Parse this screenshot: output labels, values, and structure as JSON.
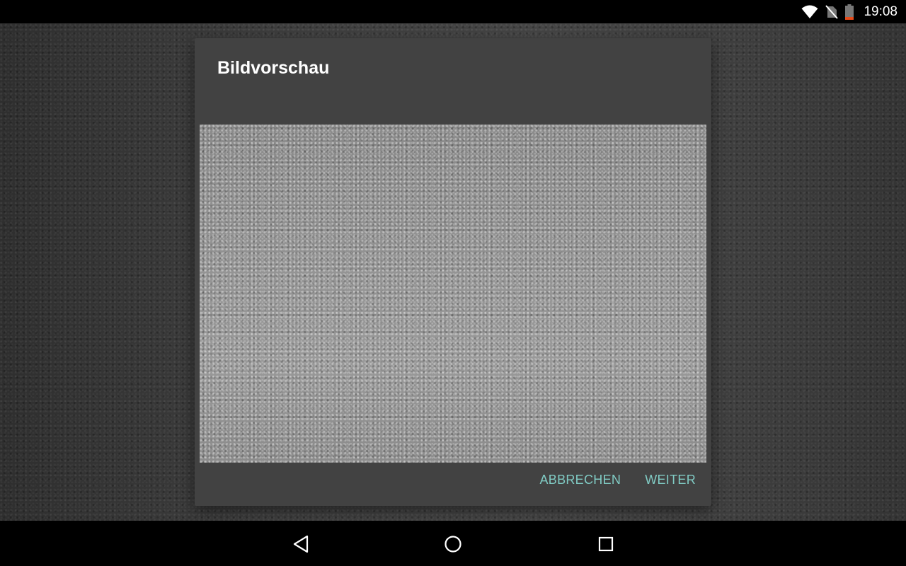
{
  "status_bar": {
    "time": "19:08",
    "icons": [
      "wifi-icon",
      "no-sim-icon",
      "battery-low-icon"
    ]
  },
  "dialog": {
    "title": "Bildvorschau",
    "preview_image": "textured-wall-photo",
    "cancel_label": "ABBRECHEN",
    "continue_label": "WEITER"
  },
  "nav_bar": {
    "icons": [
      "back-icon",
      "home-icon",
      "recents-icon"
    ]
  },
  "colors": {
    "dialog_background": "#424242",
    "accent": "#80cbc4",
    "status_bar": "#000000",
    "nav_bar": "#000000"
  }
}
